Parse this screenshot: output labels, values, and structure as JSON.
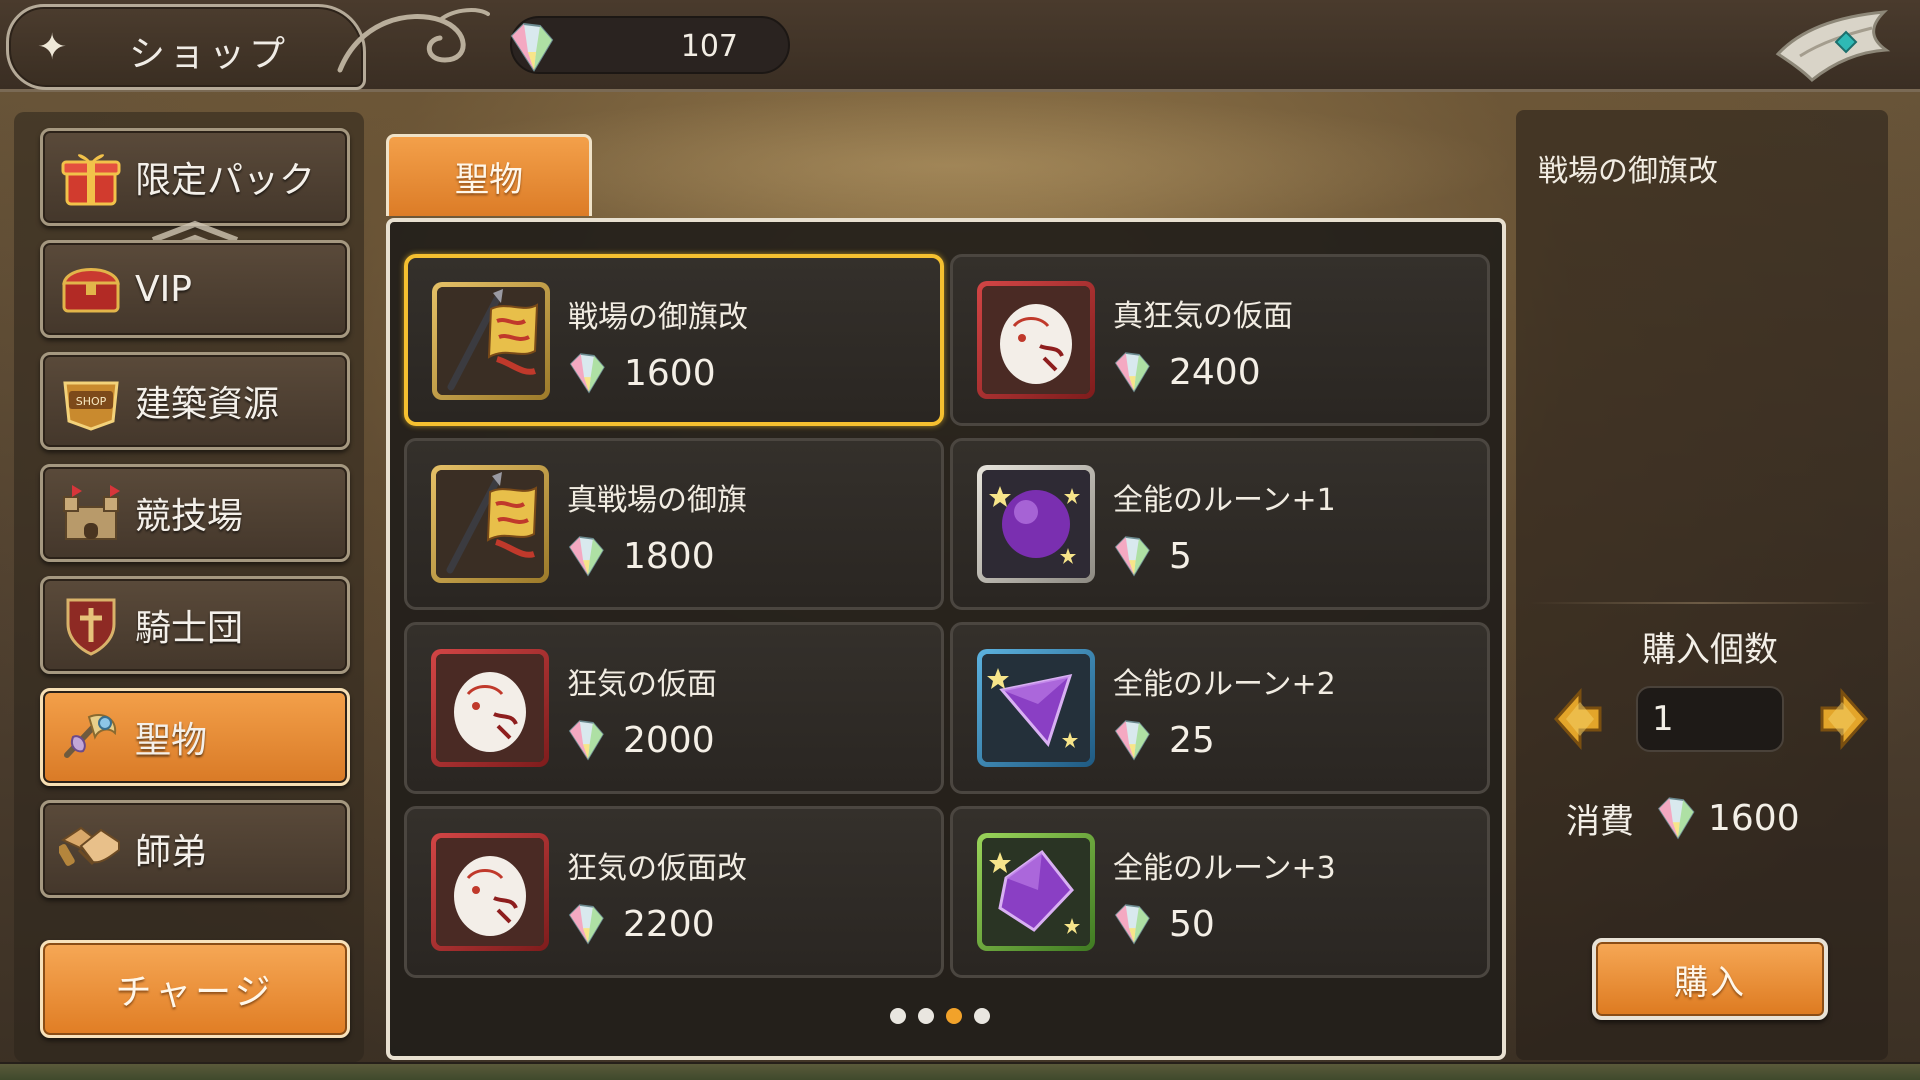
{
  "header": {
    "title": "ショップ",
    "currency_icon": "crystal-icon",
    "currency_value": "107",
    "close_icon": "winged-back-icon"
  },
  "sidebar": {
    "items": [
      {
        "label": "限定パック",
        "icon": "gift-box-icon",
        "active": false
      },
      {
        "label": "VIP",
        "icon": "treasure-chest-icon",
        "active": false
      },
      {
        "label": "建築資源",
        "icon": "shop-sign-icon",
        "active": false
      },
      {
        "label": "競技場",
        "icon": "castle-icon",
        "active": false
      },
      {
        "label": "騎士団",
        "icon": "shield-crest-icon",
        "active": false
      },
      {
        "label": "聖物",
        "icon": "relic-icon",
        "active": true
      },
      {
        "label": "師弟",
        "icon": "handshake-icon",
        "active": false
      }
    ],
    "charge_label": "チャージ"
  },
  "main": {
    "tab_label": "聖物",
    "items": [
      {
        "name": "戦場の御旗改",
        "price": "1600",
        "icon": "battle-flag-icon",
        "frame": "gold",
        "selected": true
      },
      {
        "name": "真狂気の仮面",
        "price": "2400",
        "icon": "madness-mask-icon",
        "frame": "red",
        "selected": false
      },
      {
        "name": "真戦場の御旗",
        "price": "1800",
        "icon": "battle-flag-icon",
        "frame": "gold",
        "selected": false
      },
      {
        "name": "全能のルーン+1",
        "price": "5",
        "icon": "purple-orb-icon",
        "frame": "silver",
        "selected": false
      },
      {
        "name": "狂気の仮面",
        "price": "2000",
        "icon": "madness-mask-icon",
        "frame": "red",
        "selected": false
      },
      {
        "name": "全能のルーン+2",
        "price": "25",
        "icon": "purple-shard-icon",
        "frame": "blue",
        "selected": false
      },
      {
        "name": "狂気の仮面改",
        "price": "2200",
        "icon": "madness-mask-icon",
        "frame": "red",
        "selected": false
      },
      {
        "name": "全能のルーン+3",
        "price": "50",
        "icon": "purple-gem-icon",
        "frame": "green",
        "selected": false
      }
    ],
    "pagination": {
      "total": 4,
      "current": 3
    }
  },
  "detail": {
    "item_name": "戦場の御旗改",
    "quantity_label": "購入個数",
    "quantity_value": "1",
    "cost_label": "消費",
    "cost_value": "1600",
    "buy_label": "購入"
  },
  "colors": {
    "accent_orange": "#e8892f",
    "selection_gold": "#f5c030",
    "panel_dark": "#2a2622"
  }
}
